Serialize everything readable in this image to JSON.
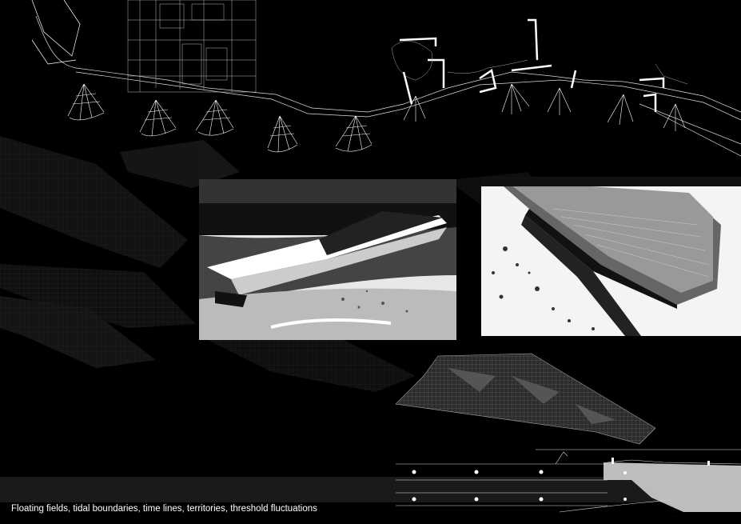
{
  "caption": "Floating fields, tidal boundaries, time lines, territories, threshold fluctuations",
  "credit": "...",
  "colors": {
    "background": "#000000",
    "line": "#ffffff",
    "ground": "#bdbdbd"
  }
}
